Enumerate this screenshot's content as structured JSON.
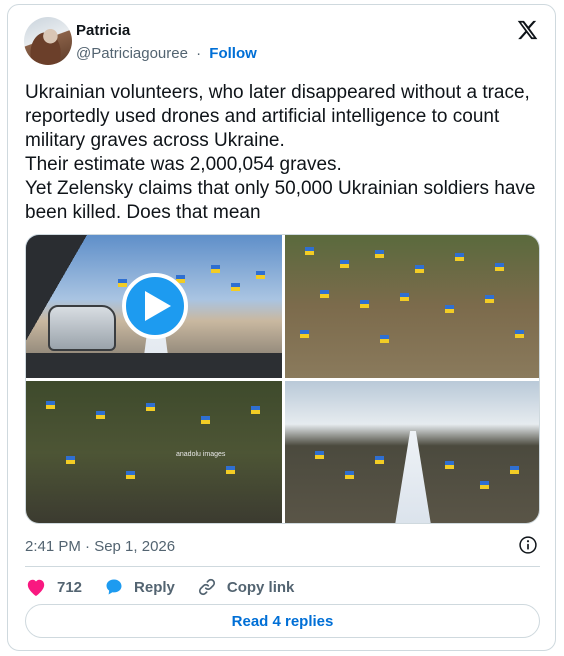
{
  "author": {
    "display_name": "Patricia",
    "handle": "@Patriciagouree",
    "separator": "·",
    "follow_label": "Follow"
  },
  "tweet": {
    "lines": [
      "Ukrainian volunteers, who later disappeared without a trace, reportedly used drones and artificial intelligence to count military graves across Ukraine.",
      "Their estimate was 2,000,054 graves.",
      "Yet Zelensky claims that only 50,000 Ukrainian soldiers have been killed. Does that mean"
    ],
    "timestamp": "2:41 PM · Sep 1, 2026"
  },
  "media": {
    "watermark": "anadolu images"
  },
  "actions": {
    "like_count": "712",
    "reply_label": "Reply",
    "copy_link_label": "Copy link"
  },
  "footer": {
    "read_replies_label": "Read 4 replies"
  },
  "colors": {
    "accent_blue": "#006fd6",
    "like_pink": "#f91880",
    "play_blue": "#1d9bf0",
    "flag_blue": "#2f6fd1",
    "flag_yellow": "#f2cc25"
  },
  "icons": {
    "logo": "x-logo-icon",
    "play": "play-icon",
    "info": "info-icon",
    "like": "heart-icon",
    "reply": "speech-bubble-icon",
    "copy_link": "link-icon"
  }
}
